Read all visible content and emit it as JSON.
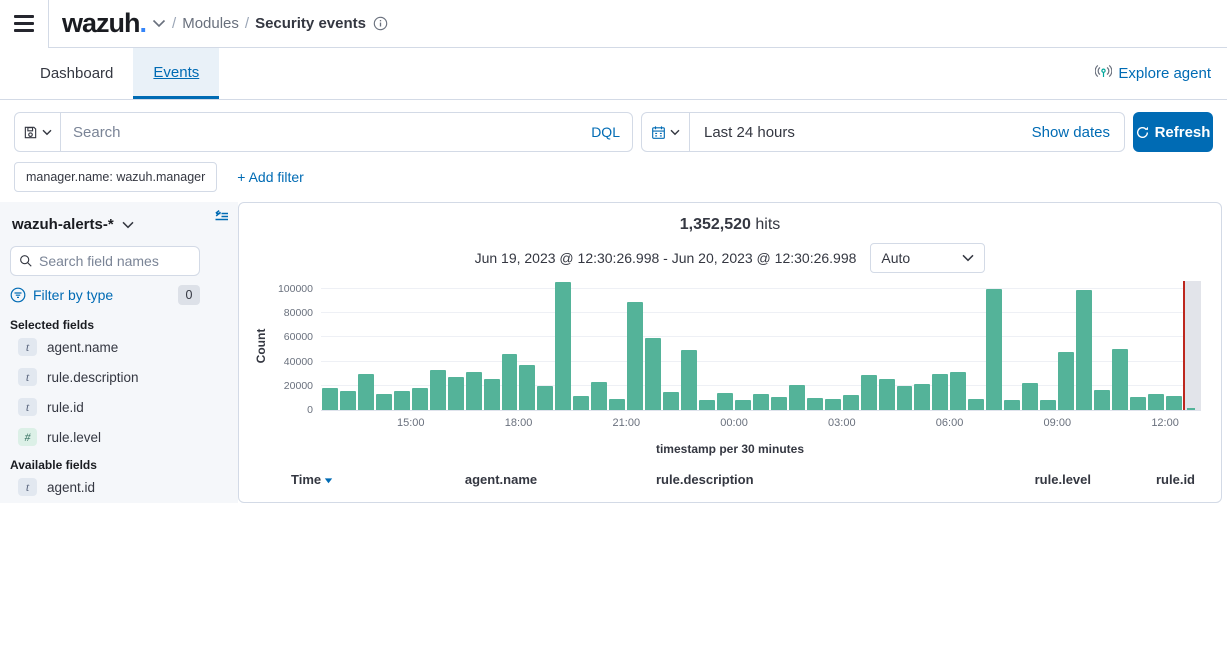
{
  "header": {
    "logo_text": "wazuh",
    "logo_dot": ".",
    "breadcrumb": {
      "separator": "/",
      "section": "Modules",
      "page": "Security events"
    }
  },
  "tabs": {
    "items": [
      {
        "label": "Dashboard"
      },
      {
        "label": "Events"
      }
    ],
    "explore_agent_label": "Explore agent"
  },
  "query_bar": {
    "search_placeholder": "Search",
    "language_label": "DQL",
    "time_range": "Last 24 hours",
    "show_dates_label": "Show dates",
    "refresh_label": "Refresh"
  },
  "filters": {
    "pill": "manager.name: wazuh.manager",
    "add_filter_label": "+ Add filter"
  },
  "sidebar": {
    "index_pattern": "wazuh-alerts-*",
    "search_placeholder": "Search field names",
    "filter_by_type_label": "Filter by type",
    "filter_count": "0",
    "selected_heading": "Selected fields",
    "available_heading": "Available fields",
    "selected_fields": [
      {
        "type": "t",
        "name": "agent.name"
      },
      {
        "type": "t",
        "name": "rule.description"
      },
      {
        "type": "t",
        "name": "rule.id"
      },
      {
        "type": "#",
        "name": "rule.level"
      }
    ],
    "available_fields": [
      {
        "type": "t",
        "name": "agent.id"
      }
    ]
  },
  "results": {
    "hits_count": "1,352,520",
    "hits_label": "hits",
    "date_range": "Jun 19, 2023 @ 12:30:26.998 - Jun 20, 2023 @ 12:30:26.998",
    "interval_selected": "Auto"
  },
  "chart_data": {
    "type": "bar",
    "title": "1,352,520 hits",
    "ylabel": "Count",
    "xlabel": "timestamp per 30 minutes",
    "ylim": [
      0,
      106000
    ],
    "y_ticks": [
      0,
      20000,
      40000,
      60000,
      80000,
      100000
    ],
    "x_ticks": [
      "15:00",
      "18:00",
      "21:00",
      "00:00",
      "03:00",
      "06:00",
      "09:00",
      "12:00"
    ],
    "x_start": "Jun 19, 2023 12:30",
    "x_end": "Jun 20, 2023 12:30",
    "bucket_minutes": 30,
    "values": [
      18000,
      15500,
      30000,
      13500,
      15500,
      18000,
      33000,
      27000,
      31500,
      26000,
      46000,
      37500,
      19500,
      106000,
      11500,
      23500,
      9500,
      89500,
      59500,
      14500,
      49500,
      8500,
      14000,
      8500,
      13000,
      10500,
      21000,
      10000,
      9000,
      12500,
      29000,
      25500,
      19500,
      21500,
      29500,
      31500,
      9500,
      100000,
      8500,
      22000,
      8000,
      48000,
      99500,
      16500,
      50500,
      11000,
      13000,
      11500
    ],
    "partial_bucket_value": 1500,
    "bar_color": "#54b399",
    "time_marker_color": "#bd271e",
    "grid": true,
    "legend": "none"
  },
  "table": {
    "columns": [
      {
        "label": "Time",
        "sort": "desc"
      },
      {
        "label": "agent.name"
      },
      {
        "label": "rule.description"
      },
      {
        "label": "rule.level"
      },
      {
        "label": "rule.id"
      }
    ]
  }
}
